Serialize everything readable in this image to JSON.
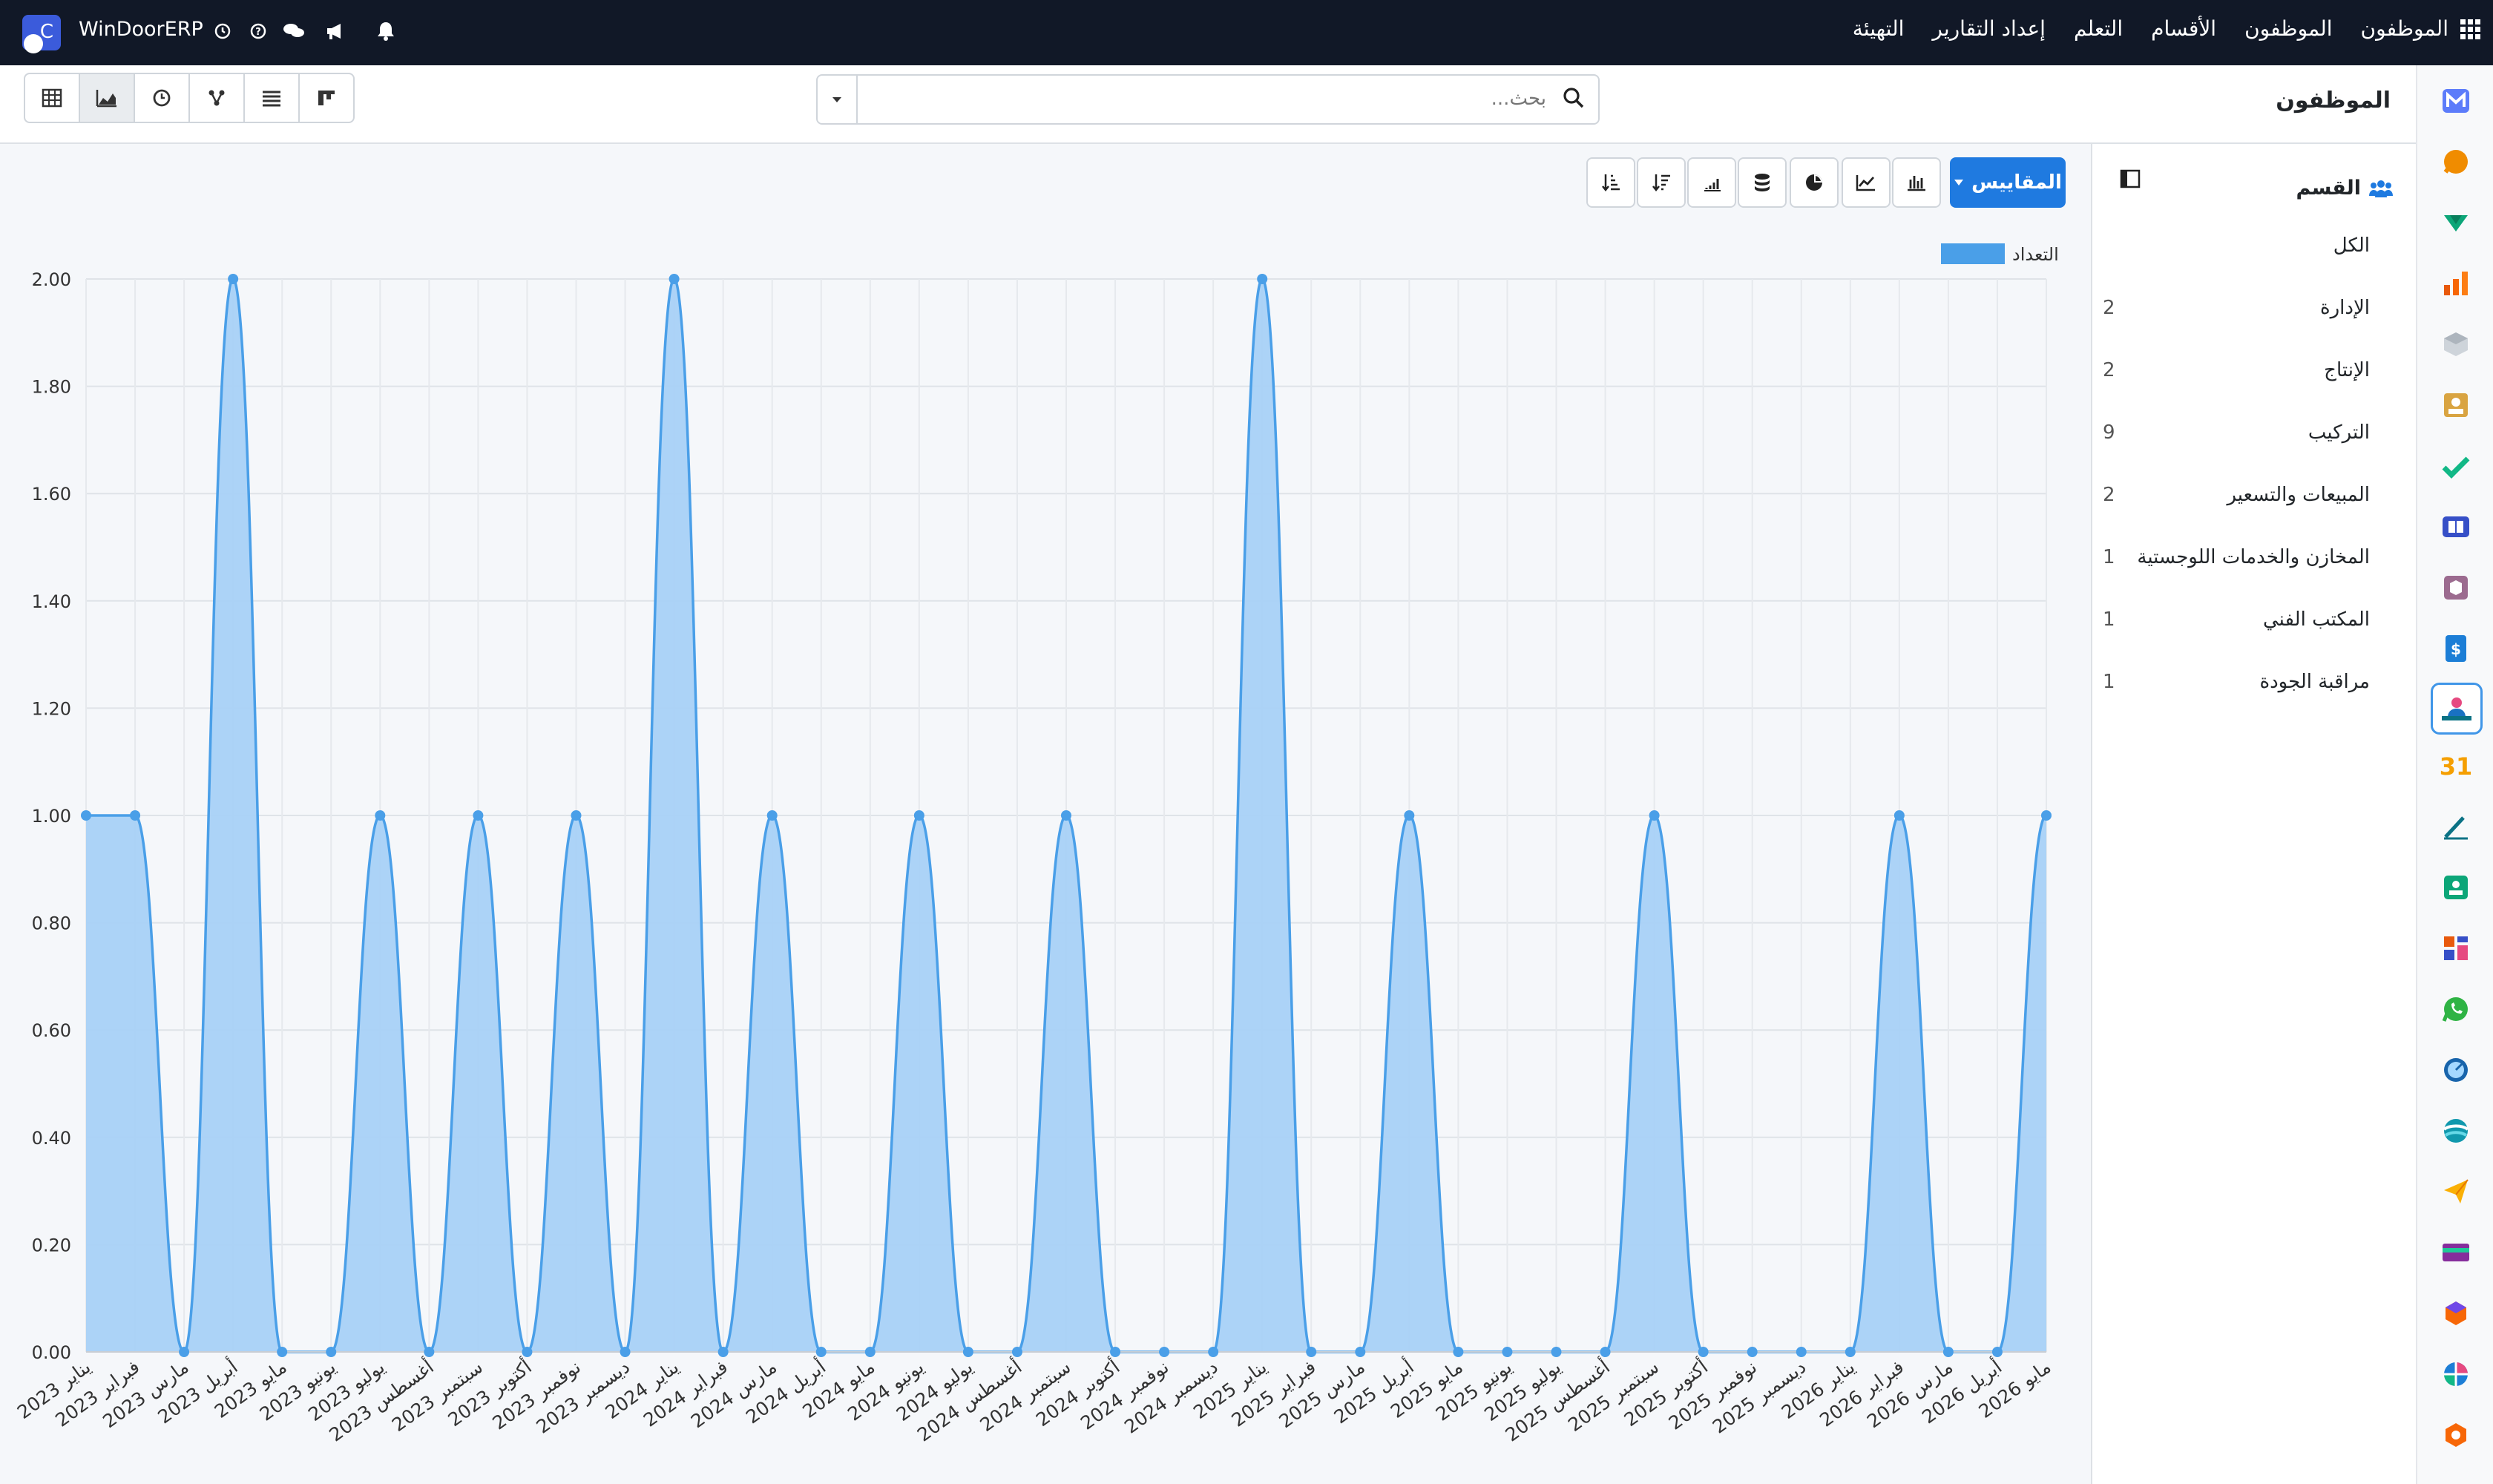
{
  "app": {
    "brand": "WinDoorERP"
  },
  "topnav": {
    "menu": [
      "الموظفون",
      "الموظفون",
      "الأقسام",
      "التعلم",
      "إعداد التقارير",
      "التهيئة"
    ]
  },
  "control_panel": {
    "title": "الموظفون",
    "search_placeholder": "بحث..."
  },
  "toolbar": {
    "measures_label": "المقاييس"
  },
  "side_panel": {
    "header": "القسم",
    "items": [
      {
        "label": "الكل",
        "count": ""
      },
      {
        "label": "الإدارة",
        "count": "2"
      },
      {
        "label": "الإنتاج",
        "count": "2"
      },
      {
        "label": "التركيب",
        "count": "9"
      },
      {
        "label": "المبيعات والتسعير",
        "count": "2"
      },
      {
        "label": "المخازن والخدمات اللوجستية",
        "count": "1"
      },
      {
        "label": "المكتب الفني",
        "count": "1"
      },
      {
        "label": "مراقبة الجودة",
        "count": "1"
      }
    ]
  },
  "colors": {
    "accent": "#1f7ae0",
    "series_line": "#4a9fe8",
    "series_fill": "#a8d1f7",
    "topbar": "#111827"
  },
  "chart_data": {
    "type": "area",
    "legend": "top-right",
    "grid": true,
    "ylim": [
      0,
      2
    ],
    "yticks": [
      "2.00",
      "1.80",
      "1.60",
      "1.40",
      "1.20",
      "1.00",
      "0.80",
      "0.60",
      "0.40",
      "0.20",
      "0.00"
    ],
    "categories": [
      "يناير 2023",
      "فبراير 2023",
      "مارس 2023",
      "أبريل 2023",
      "مايو 2023",
      "يونيو 2023",
      "يوليو 2023",
      "أغسطس 2023",
      "سبتمبر 2023",
      "أكتوبر 2023",
      "نوفمبر 2023",
      "ديسمبر 2023",
      "يناير 2024",
      "فبراير 2024",
      "مارس 2024",
      "أبريل 2024",
      "مايو 2024",
      "يونيو 2024",
      "يوليو 2024",
      "أغسطس 2024",
      "سبتمبر 2024",
      "أكتوبر 2024",
      "نوفمبر 2024",
      "ديسمبر 2024",
      "يناير 2025",
      "فبراير 2025",
      "مارس 2025",
      "أبريل 2025",
      "مايو 2025",
      "يونيو 2025",
      "يوليو 2025",
      "أغسطس 2025",
      "سبتمبر 2025",
      "أكتوبر 2025",
      "نوفمبر 2025",
      "ديسمبر 2025",
      "يناير 2026",
      "فبراير 2026",
      "مارس 2026",
      "أبريل 2026",
      "مايو 2026"
    ],
    "series": [
      {
        "name": "التعداد",
        "values": [
          1,
          1,
          0,
          2,
          0,
          0,
          1,
          0,
          1,
          0,
          1,
          0,
          2,
          0,
          1,
          0,
          0,
          1,
          0,
          0,
          1,
          0,
          0,
          0,
          2,
          0,
          0,
          1,
          0,
          0,
          0,
          0,
          1,
          0,
          0,
          0,
          0,
          1,
          0,
          0,
          1
        ]
      }
    ]
  }
}
